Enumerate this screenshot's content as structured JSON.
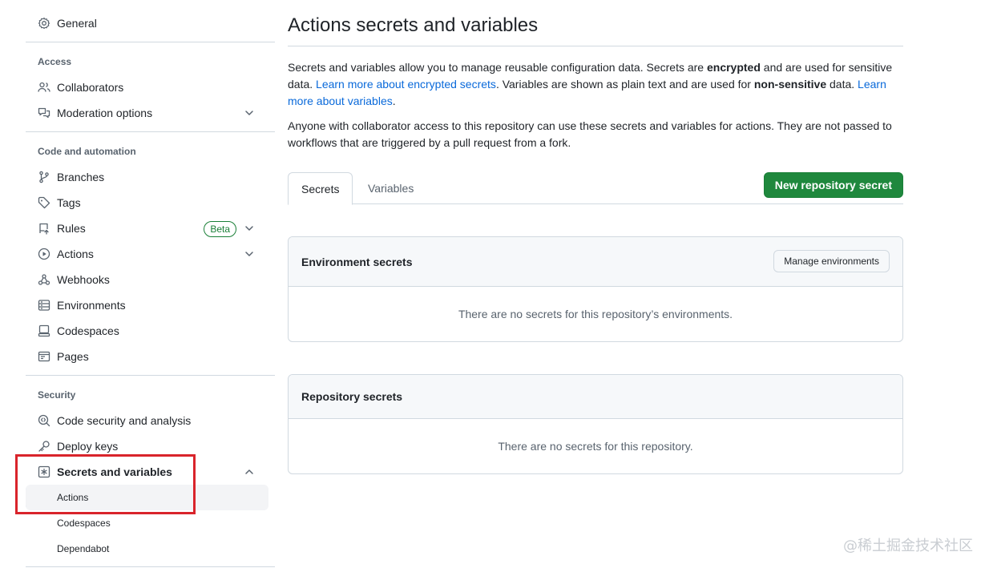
{
  "sidebar": {
    "general": "General",
    "access_title": "Access",
    "collaborators": "Collaborators",
    "moderation": "Moderation options",
    "code_title": "Code and automation",
    "branches": "Branches",
    "tags": "Tags",
    "rules": "Rules",
    "rules_badge": "Beta",
    "actions": "Actions",
    "webhooks": "Webhooks",
    "environments": "Environments",
    "codespaces": "Codespaces",
    "pages": "Pages",
    "security_title": "Security",
    "code_security": "Code security and analysis",
    "deploy_keys": "Deploy keys",
    "secrets_variables": "Secrets and variables",
    "sub_items": [
      "Actions",
      "Codespaces",
      "Dependabot"
    ]
  },
  "main": {
    "title": "Actions secrets and variables",
    "intro": {
      "p1_a": "Secrets and variables allow you to manage reusable configuration data. Secrets are ",
      "p1_b": "encrypted",
      "p1_c": " and are used for sensitive data. ",
      "p1_link1": "Learn more about encrypted secrets",
      "p1_d": ". Variables are shown as plain text and are used for ",
      "p1_e": "non-sensitive",
      "p1_f": " data. ",
      "p1_link2": "Learn more about variables",
      "p1_g": ".",
      "p2": "Anyone with collaborator access to this repository can use these secrets and variables for actions. They are not passed to workflows that are triggered by a pull request from a fork."
    },
    "tabs": [
      "Secrets",
      "Variables"
    ],
    "new_secret_button": "New repository secret",
    "env_box": {
      "title": "Environment secrets",
      "button": "Manage environments",
      "empty": "There are no secrets for this repository’s environments."
    },
    "repo_box": {
      "title": "Repository secrets",
      "empty": "There are no secrets for this repository."
    }
  },
  "watermark": "@稀土掘金技术社区",
  "colors": {
    "accent": "#0969da",
    "primary_button": "#1f883d",
    "highlight": "#d9242b",
    "badge_green": "#1a7f37"
  }
}
